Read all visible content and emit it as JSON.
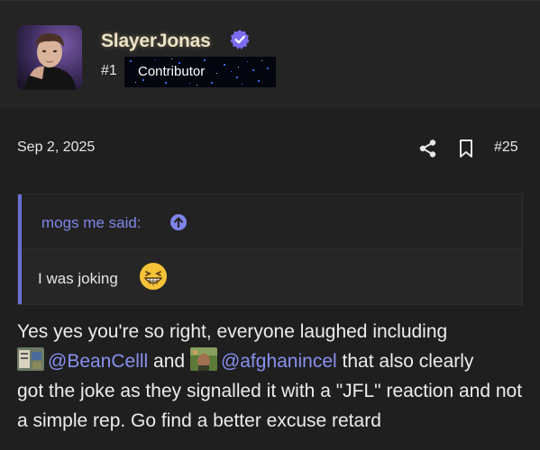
{
  "header": {
    "username": "SlayerJonas",
    "rank": "#1",
    "badge_label": "Contributor"
  },
  "post": {
    "date": "Sep 2, 2025",
    "number": "#25"
  },
  "quote": {
    "author": "mogs me said:",
    "text": "I was joking"
  },
  "message": {
    "line1": "Yes yes you're so right, everyone laughed including",
    "mention1": "@BeanCelll",
    "and_word": " and ",
    "mention2": "@afghanincel",
    "after_mention": " that also clearly",
    "rest": "got the joke as they signalled it with a \"JFL\" reaction and not a simple rep. Go find a better excuse retard"
  },
  "colors": {
    "accent": "#7f85e8",
    "verified": "#7c6cf0",
    "username": "#ece3c7"
  }
}
